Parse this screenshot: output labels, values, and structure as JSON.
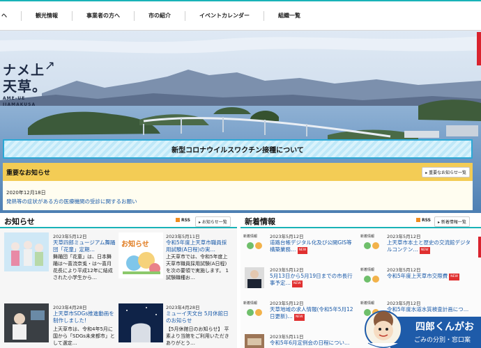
{
  "nav": {
    "items": [
      "ヘ",
      "観光情報",
      "事業者の方へ",
      "市の紹介",
      "イベントカレンダー",
      "組織一覧"
    ]
  },
  "hero": {
    "title_line1": "ナメ上",
    "title_arrow": "↗",
    "title_line2": "天草。",
    "subtitle_line1": "AME-UE",
    "subtitle_line2": "IIAMAKUSA"
  },
  "covid_banner": {
    "label": "新型コロナウイルスワクチン接種について"
  },
  "important": {
    "title": "重要なお知らせ",
    "list_link": "重要なお知らせ一覧",
    "date": "2020年12月18日",
    "text": "発熱等の症状がある方の医療機関の受診に関するお願い"
  },
  "notices": {
    "title": "お知らせ",
    "rss": "RSS",
    "list_link": "お知らせ一覧",
    "items": [
      {
        "date": "2023年5月12日",
        "title": "天草四郎ミュージアム舞踊団「花童」定期…",
        "body": "舞踊団「花童」は、日本舞踊は〜喜流奈兎・は〜喜月花長により平成12年に結成された小学生から…"
      },
      {
        "date": "2023年5月11日",
        "title": "令和5年度上天草市職員採用試験(A日程)の実…",
        "body": "上天草市では、令和5年度上天草市職員採用試験(A日程)を次の要領で実施します。 1 試験職種お…",
        "thumb_label": "お知らせ"
      },
      {
        "date": "2023年4月28日",
        "title": "上天草市SDGs推進動画を制作しました!",
        "body": "上天草市は、令和4年5月に国から「SDGs未来都市」として選定…"
      },
      {
        "date": "2023年4月28日",
        "title": "ミューイ天文台 5月休館日のお知らせ",
        "body": "【5月休館日のお知らせ】 平素より当館をご利用いただきありがとう…"
      }
    ]
  },
  "whatsnew": {
    "title": "新着情報",
    "rss": "RSS",
    "list_link": "新着情報一覧",
    "thumb_label": "新着情報",
    "items": [
      {
        "date": "2023年5月12日",
        "title": "道路台帳デジタル化及び公開GIS等構築業務…",
        "new": "NEW"
      },
      {
        "date": "2023年5月12日",
        "title": "上天草市本土と歴史の交流館デジタルコンテン…",
        "new": "NEW"
      },
      {
        "date": "2023年5月12日",
        "title": "5月13日から5月19日までの市長行事予定…",
        "new": "NEW"
      },
      {
        "date": "2023年5月12日",
        "title": "令和5年度上天草市交際費",
        "new": "NEW"
      },
      {
        "date": "2023年5月12日",
        "title": "天草地域の求人情報(令和5年5月12日更新)…",
        "new": "NEW"
      },
      {
        "date": "2023年5月12日",
        "title": "令和5年度水道水質検査計画につ…",
        "new": ""
      },
      {
        "date": "2023年5月11日",
        "title": "令和5年6月定例会の日程につい…",
        "new": ""
      }
    ]
  },
  "mascot": {
    "name": "四郎くんがお",
    "sub": "ごみの分別・窓口案"
  },
  "colors": {
    "accent": "#19b3b8",
    "important_bar": "#f3cc55",
    "covid_border": "#2ba9d6",
    "link": "#1a5aa8",
    "mascot_bar": "#1e5ba9"
  }
}
